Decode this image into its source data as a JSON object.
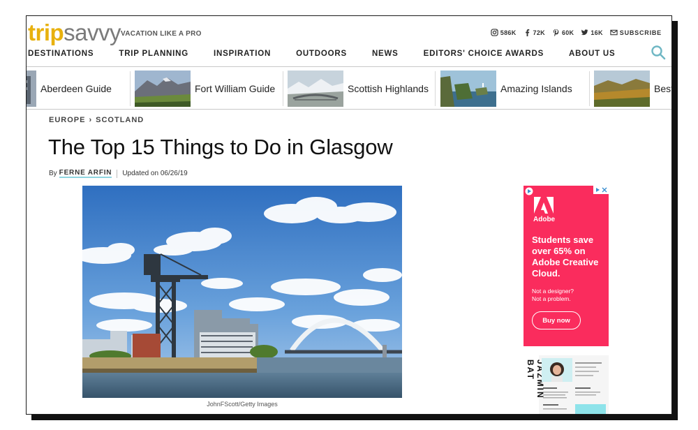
{
  "header": {
    "logo_trip": "trip",
    "logo_savvy": "savvy",
    "tagline": "VACATION LIKE A PRO",
    "social": [
      {
        "icon": "instagram-icon",
        "count": "586K"
      },
      {
        "icon": "facebook-icon",
        "count": "72K"
      },
      {
        "icon": "pinterest-icon",
        "count": "60K"
      },
      {
        "icon": "twitter-icon",
        "count": "16K"
      },
      {
        "icon": "mail-icon",
        "count": "SUBSCRIBE"
      }
    ],
    "nav": [
      "DESTINATIONS",
      "TRIP PLANNING",
      "INSPIRATION",
      "OUTDOORS",
      "NEWS",
      "EDITORS' CHOICE AWARDS",
      "ABOUT US"
    ]
  },
  "strip": [
    {
      "label": "Aberdeen Guide"
    },
    {
      "label": "Fort William Guide"
    },
    {
      "label": "Scottish Highlands"
    },
    {
      "label": "Amazing Islands"
    },
    {
      "label": "Best"
    }
  ],
  "article": {
    "breadcrumb": [
      "EUROPE",
      "SCOTLAND"
    ],
    "breadcrumb_sep": "›",
    "title": "The Top 15 Things to Do in Glasgow",
    "by": "By",
    "author": "FERNE ARFIN",
    "updated": "Updated on 06/26/19",
    "caption": "JohnFScott/Getty Images"
  },
  "ad": {
    "brand": "Adobe",
    "headline": "Students save over 65% on Adobe Creative Cloud.",
    "sub_line1": "Not a designer?",
    "sub_line2": "Not a problem.",
    "button": "Buy now",
    "resume_name": "JAZMIN BAT",
    "accent": "#fa2c5d"
  },
  "colors": {
    "logo_yellow": "#e8b10e",
    "logo_gray": "#7b7b7b",
    "author_underline": "#8fd5e0"
  }
}
